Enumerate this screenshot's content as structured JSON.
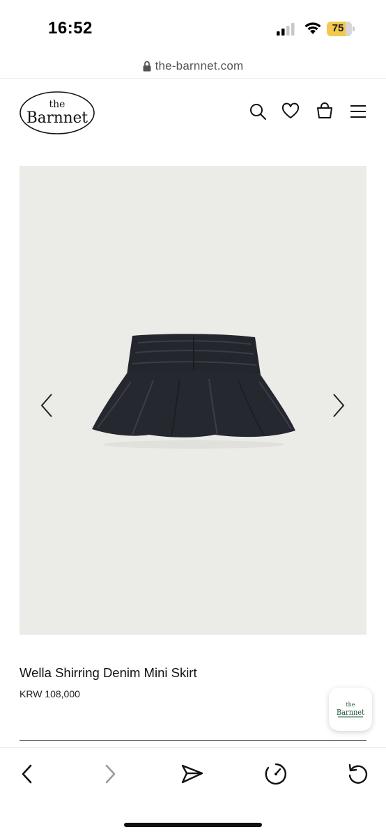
{
  "status_bar": {
    "time": "16:52",
    "battery_level": "75",
    "icons": [
      "signal-icon",
      "wifi-icon",
      "battery-icon"
    ],
    "battery_color": "#f2c94c"
  },
  "browser": {
    "url": "the-barnnet.com",
    "toolbar_icons": [
      "back-icon",
      "forward-icon",
      "share-icon",
      "speed-icon",
      "reload-icon"
    ]
  },
  "header": {
    "logo_top": "the",
    "logo_main": "Barnnet",
    "icons": [
      "search-icon",
      "heart-icon",
      "shopping-bag-icon",
      "menu-icon"
    ]
  },
  "gallery": {
    "image_subject": "black mini skirt",
    "background_color": "#ebebe8"
  },
  "product": {
    "name": "Wella Shirring Denim Mini Skirt",
    "price": "KRW 108,000"
  },
  "floating_badge": {
    "logo_top": "the",
    "logo_main": "Barnnet"
  }
}
